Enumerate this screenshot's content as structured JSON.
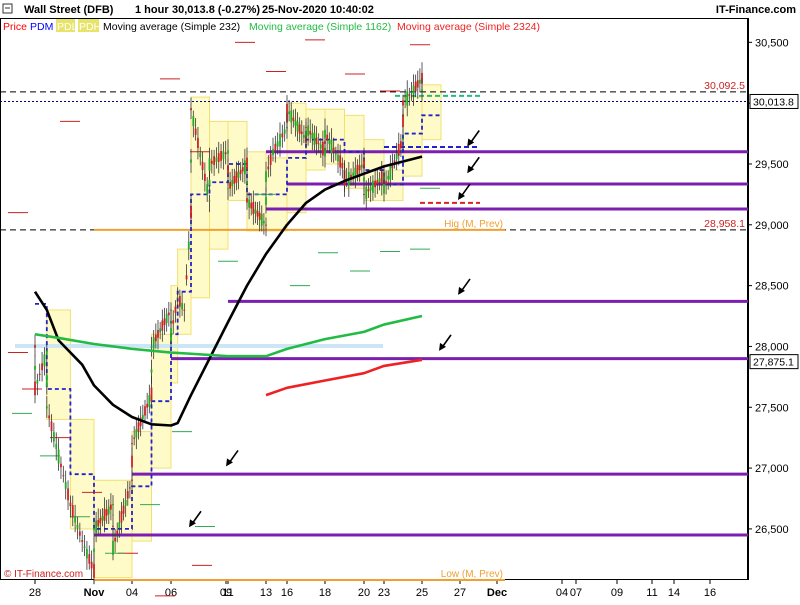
{
  "header": {
    "instrument": "Wall Street (DFB)",
    "timeframe": "1 hour",
    "last_price": "30,013.8 (-0.27%)",
    "datetime": "25-Nov-2020 10:40:02",
    "brand": "IT-Finance.com"
  },
  "legend": [
    {
      "label": "Price",
      "color": "#ff0000",
      "bg": ""
    },
    {
      "label": "PDM",
      "color": "#0000ff",
      "bg": ""
    },
    {
      "label": "PDL",
      "color": "#ffffff",
      "bg": "#e8e46a"
    },
    {
      "label": "PDH",
      "color": "#ffffff",
      "bg": "#e8e46a"
    },
    {
      "label": "Moving average (Simple 232)",
      "color": "#000000",
      "bg": ""
    },
    {
      "label": "Moving average (Simple 1162)",
      "color": "#22bb44",
      "bg": ""
    },
    {
      "label": "Moving average (Simple 2324)",
      "color": "#ee2222",
      "bg": ""
    }
  ],
  "watermark": "© IT-Finance.com",
  "chart_data": {
    "type": "line",
    "y_axis": {
      "ticks": [
        "30,500",
        "30,000",
        "29,500",
        "29,000",
        "28,500",
        "28,000",
        "27,500",
        "27,000",
        "26,500"
      ],
      "tick_values": [
        30500,
        30000,
        29500,
        29000,
        28500,
        28000,
        27500,
        27000,
        26500
      ],
      "range": [
        26080,
        30700
      ],
      "side": "right"
    },
    "x_axis": {
      "labels": [
        "28",
        "Nov",
        "04",
        "06",
        "09",
        "11",
        "13",
        "16",
        "18",
        "20",
        "23",
        "25",
        "27",
        "Dec",
        "04",
        "07",
        "09",
        "11",
        "14",
        "16"
      ],
      "bold": [
        "Nov",
        "Dec"
      ],
      "start": "2020-10-28",
      "end": "2020-12-18"
    },
    "price_tags": [
      {
        "label": "30,013.8",
        "value": 30013.8,
        "boxed": true
      },
      {
        "label": "27,875.1",
        "value": 27875.1,
        "boxed": true
      },
      {
        "label": "30,092.5",
        "value": 30092.5,
        "boxed": false
      },
      {
        "label": "28,958.1",
        "value": 28958.1,
        "boxed": false
      }
    ],
    "annotations": [
      {
        "label": "Hig (M, Prev)",
        "value": 28958.1,
        "color": "#f0a030"
      },
      {
        "label": "Low (M, Prev)",
        "value": 26080,
        "color": "#f0a030"
      }
    ],
    "reference_lines": [
      {
        "value": 30092.5,
        "style": "dashed",
        "color": "#000000"
      },
      {
        "value": 30013.8,
        "style": "dotted",
        "color": "#000080"
      },
      {
        "value": 28958.1,
        "style": "dashed",
        "color": "#000000"
      }
    ],
    "support_resistance": [
      {
        "value": 29600,
        "from": "2020-11-13",
        "color": "#7a1fb0"
      },
      {
        "value": 29335,
        "from": "2020-11-16",
        "color": "#7a1fb0"
      },
      {
        "value": 29130,
        "from": "2020-11-13",
        "color": "#7a1fb0"
      },
      {
        "value": 28370,
        "from": "2020-11-11",
        "color": "#7a1fb0"
      },
      {
        "value": 27900,
        "from": "2020-11-06",
        "color": "#7a1fb0"
      },
      {
        "value": 26950,
        "from": "2020-11-04",
        "color": "#7a1fb0"
      },
      {
        "value": 26450,
        "from": "2020-11-02",
        "color": "#7a1fb0"
      }
    ],
    "arrows_near": [
      {
        "date": "2020-11-28",
        "value": 29660
      },
      {
        "date": "2020-11-28",
        "value": 29440
      },
      {
        "date": "2020-11-27",
        "value": 29220
      },
      {
        "date": "2020-11-27",
        "value": 28440
      },
      {
        "date": "2020-11-26",
        "value": 27980
      },
      {
        "date": "2020-11-11",
        "value": 27030
      },
      {
        "date": "2020-11-09",
        "value": 26530
      }
    ],
    "series": [
      {
        "name": "Moving average (Simple 232)",
        "color": "#000000",
        "points": [
          [
            "2020-10-28",
            28450
          ],
          [
            "2020-10-29",
            28300
          ],
          [
            "2020-10-30",
            28050
          ],
          [
            "2020-11-01",
            27850
          ],
          [
            "2020-11-02",
            27680
          ],
          [
            "2020-11-03",
            27520
          ],
          [
            "2020-11-04",
            27420
          ],
          [
            "2020-11-05",
            27360
          ],
          [
            "2020-11-06",
            27350
          ],
          [
            "2020-11-07",
            27370
          ],
          [
            "2020-11-09",
            27600
          ],
          [
            "2020-11-10",
            27900
          ],
          [
            "2020-11-11",
            28200
          ],
          [
            "2020-11-12",
            28500
          ],
          [
            "2020-11-13",
            28760
          ],
          [
            "2020-11-16",
            29000
          ],
          [
            "2020-11-17",
            29180
          ],
          [
            "2020-11-18",
            29290
          ],
          [
            "2020-11-19",
            29360
          ],
          [
            "2020-11-20",
            29420
          ],
          [
            "2020-11-23",
            29480
          ],
          [
            "2020-11-24",
            29520
          ],
          [
            "2020-11-25",
            29560
          ]
        ]
      },
      {
        "name": "Moving average (Simple 1162)",
        "color": "#22bb44",
        "points": [
          [
            "2020-10-28",
            28100
          ],
          [
            "2020-10-30",
            28070
          ],
          [
            "2020-11-02",
            28020
          ],
          [
            "2020-11-04",
            27980
          ],
          [
            "2020-11-06",
            27950
          ],
          [
            "2020-11-09",
            27940
          ],
          [
            "2020-11-11",
            27920
          ],
          [
            "2020-11-13",
            27920
          ],
          [
            "2020-11-16",
            27980
          ],
          [
            "2020-11-18",
            28060
          ],
          [
            "2020-11-20",
            28120
          ],
          [
            "2020-11-23",
            28180
          ],
          [
            "2020-11-25",
            28250
          ]
        ]
      },
      {
        "name": "Moving average (Simple 2324)",
        "color": "#ee2222",
        "points": [
          [
            "2020-11-13",
            27600
          ],
          [
            "2020-11-16",
            27660
          ],
          [
            "2020-11-18",
            27720
          ],
          [
            "2020-11-20",
            27780
          ],
          [
            "2020-11-23",
            27840
          ],
          [
            "2020-11-25",
            27890
          ]
        ]
      }
    ],
    "price_path": [
      [
        "2020-10-28",
        28000
      ],
      [
        "2020-10-28",
        27650
      ],
      [
        "2020-10-29",
        27950
      ],
      [
        "2020-10-29",
        27500
      ],
      [
        "2020-10-30",
        27100
      ],
      [
        "2020-10-31",
        26700
      ],
      [
        "2020-11-01",
        26400
      ],
      [
        "2020-11-02",
        26150
      ],
      [
        "2020-11-02",
        26500
      ],
      [
        "2020-11-03",
        26700
      ],
      [
        "2020-11-03",
        26350
      ],
      [
        "2020-11-04",
        26900
      ],
      [
        "2020-11-04",
        27200
      ],
      [
        "2020-11-05",
        27600
      ],
      [
        "2020-11-05",
        28000
      ],
      [
        "2020-11-06",
        28300
      ],
      [
        "2020-11-06",
        28100
      ],
      [
        "2020-11-07",
        28400
      ],
      [
        "2020-11-08",
        28300
      ],
      [
        "2020-11-09",
        29100
      ],
      [
        "2020-11-09",
        29950
      ],
      [
        "2020-11-10",
        29200
      ],
      [
        "2020-11-10",
        29500
      ],
      [
        "2020-11-11",
        29600
      ],
      [
        "2020-11-11",
        29300
      ],
      [
        "2020-11-12",
        29500
      ],
      [
        "2020-11-12",
        29200
      ],
      [
        "2020-11-13",
        29000
      ],
      [
        "2020-11-13",
        29400
      ],
      [
        "2020-11-14",
        29600
      ],
      [
        "2020-11-16",
        29800
      ],
      [
        "2020-11-16",
        29950
      ],
      [
        "2020-11-17",
        29700
      ],
      [
        "2020-11-17",
        29800
      ],
      [
        "2020-11-18",
        29600
      ],
      [
        "2020-11-18",
        29750
      ],
      [
        "2020-11-19",
        29450
      ],
      [
        "2020-11-19",
        29350
      ],
      [
        "2020-11-20",
        29500
      ],
      [
        "2020-11-20",
        29250
      ],
      [
        "2020-11-23",
        29400
      ],
      [
        "2020-11-23",
        29300
      ],
      [
        "2020-11-24",
        29700
      ],
      [
        "2020-11-24",
        30000
      ],
      [
        "2020-11-25",
        30200
      ],
      [
        "2020-11-25",
        30013.8
      ]
    ]
  }
}
